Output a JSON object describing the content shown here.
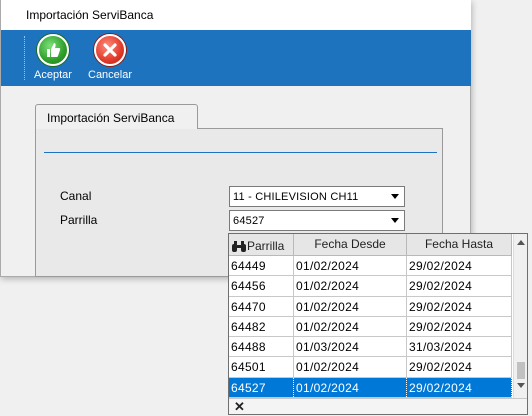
{
  "window": {
    "title": "Importación ServiBanca"
  },
  "toolbar": {
    "accept_label": "Aceptar",
    "cancel_label": "Cancelar",
    "accept_icon": "thumbs-up-icon",
    "cancel_icon": "close-circle-icon"
  },
  "tab": {
    "label": "Importación ServiBanca"
  },
  "form": {
    "canal_label": "Canal",
    "canal_value": "11 - CHILEVISION CH11",
    "parrilla_label": "Parrilla",
    "parrilla_value": "64527"
  },
  "dropdown": {
    "headers": {
      "parrilla": "Parrilla",
      "fecha_desde": "Fecha Desde",
      "fecha_hasta": "Fecha Hasta"
    },
    "search_icon": "binoculars-icon",
    "rows": [
      {
        "id": "64449",
        "desde": "01/02/2024",
        "hasta": "29/02/2024"
      },
      {
        "id": "64456",
        "desde": "01/02/2024",
        "hasta": "29/02/2024"
      },
      {
        "id": "64470",
        "desde": "01/02/2024",
        "hasta": "29/02/2024"
      },
      {
        "id": "64482",
        "desde": "01/02/2024",
        "hasta": "29/02/2024"
      },
      {
        "id": "64488",
        "desde": "01/03/2024",
        "hasta": "31/03/2024"
      },
      {
        "id": "64501",
        "desde": "01/02/2024",
        "hasta": "29/02/2024"
      },
      {
        "id": "64527",
        "desde": "01/02/2024",
        "hasta": "29/02/2024"
      }
    ],
    "selected_id": "64527",
    "close_glyph": "✕"
  },
  "colors": {
    "accent": "#1e73be",
    "selection": "#0078d7"
  }
}
